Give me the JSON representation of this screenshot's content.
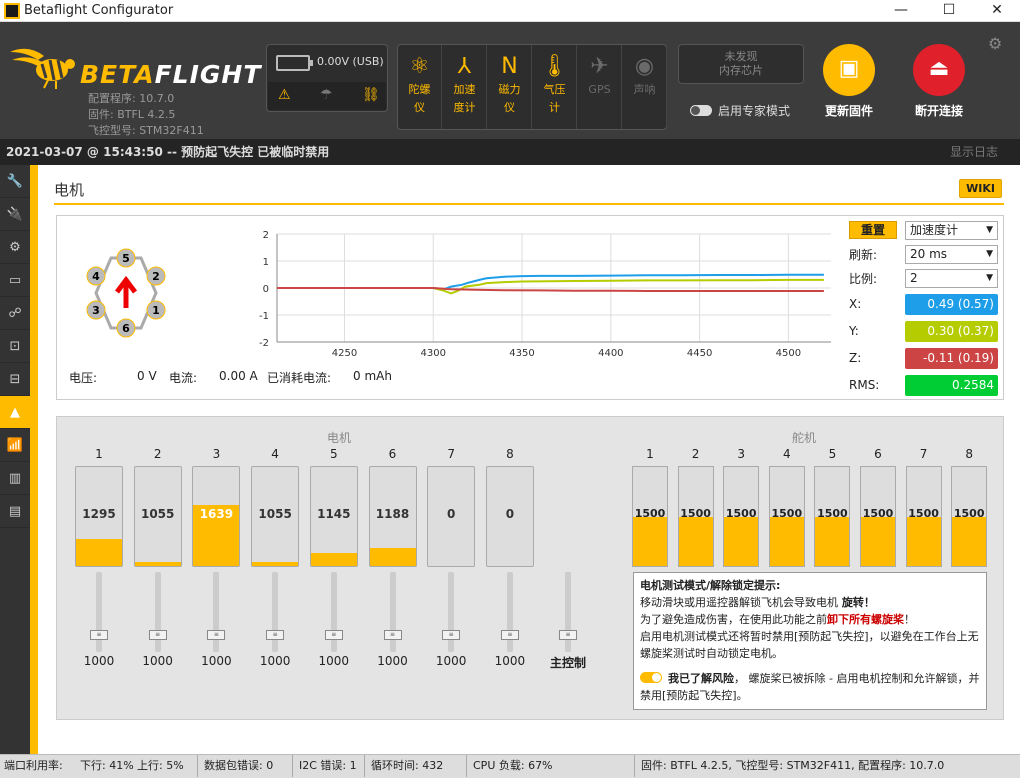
{
  "window": {
    "title": "Betaflight Configurator",
    "min": "—",
    "max": "☐",
    "close": "✕"
  },
  "header": {
    "logo_text_a": "BETA",
    "logo_text_b": "FLIGHT",
    "version_lines": [
      "配置程序: 10.7.0",
      "固件: BTFL 4.2.5",
      "飞控型号: STM32F411"
    ],
    "voltage": "0.00V (USB)",
    "sensors": [
      {
        "glyph": "⚛",
        "label_a": "陀螺",
        "label_b": "仪",
        "state": "on",
        "icon": "gyro-icon"
      },
      {
        "glyph": "⅄",
        "label_a": "加速",
        "label_b": "度计",
        "state": "on",
        "icon": "accel-icon"
      },
      {
        "glyph": "N",
        "label_a": "磁力",
        "label_b": "仪",
        "state": "on",
        "icon": "mag-icon"
      },
      {
        "glyph": "🌡",
        "label_a": "气压",
        "label_b": "计",
        "state": "on",
        "icon": "baro-icon"
      },
      {
        "glyph": "✈",
        "label_a": "GPS",
        "label_b": "",
        "state": "off",
        "icon": "gps-icon"
      },
      {
        "glyph": "◉",
        "label_a": "声呐",
        "label_b": "",
        "state": "off",
        "icon": "sonar-icon"
      }
    ],
    "chip_line1": "未发现",
    "chip_line2": "内存芯片",
    "expert_mode": "启用专家模式",
    "update_fw": "更新固件",
    "disconnect": "断开连接"
  },
  "infobar": {
    "message": "2021-03-07 @ 15:43:50 -- 预防起飞失控 已被临时禁用",
    "log": "显示日志"
  },
  "page": {
    "title": "电机",
    "wiki": "WIKI"
  },
  "telemetry": {
    "voltage_label": "电压:",
    "voltage": "0 V",
    "current_label": "电流:",
    "current": "0.00 A",
    "consumed_label": "已消耗电流:",
    "consumed": "0 mAh"
  },
  "graph_controls": {
    "reset": "重置",
    "sensor": "加速度计",
    "refresh_label": "刷新:",
    "refresh": "20 ms",
    "scale_label": "比例:",
    "scale": "2",
    "x_label": "X:",
    "x_val": "0.49 (0.57)",
    "y_label": "Y:",
    "y_val": "0.30 (0.37)",
    "z_label": "Z:",
    "z_val": "-0.11 (0.19)",
    "rms_label": "RMS:",
    "rms_val": "0.2584",
    "colors": {
      "x": "#1e9ee8",
      "y": "#b5cc00",
      "z": "#cc4444",
      "rms": "#00cc33"
    }
  },
  "chart_data": {
    "type": "line",
    "xlim": [
      4212,
      4524
    ],
    "ylim": [
      -2,
      2
    ],
    "xticks": [
      4250,
      4300,
      4350,
      4400,
      4450,
      4500
    ],
    "yticks": [
      2,
      1,
      0,
      -1,
      -2
    ],
    "series": [
      {
        "color": "#1e9ee8",
        "x": [
          4212,
          4300,
          4306,
          4310,
          4316,
          4320,
          4326,
          4330,
          4340,
          4350,
          4360,
          4380,
          4400,
          4420,
          4440,
          4460,
          4480,
          4500,
          4520
        ],
        "y": [
          0,
          0,
          -0.05,
          0.05,
          0.12,
          0.2,
          0.3,
          0.36,
          0.42,
          0.44,
          0.45,
          0.45,
          0.46,
          0.47,
          0.47,
          0.48,
          0.48,
          0.49,
          0.49
        ]
      },
      {
        "color": "#b5cc00",
        "x": [
          4212,
          4300,
          4306,
          4310,
          4314,
          4318,
          4326,
          4330,
          4340,
          4350,
          4380,
          4400,
          4420,
          4440,
          4460,
          4480,
          4500,
          4520
        ],
        "y": [
          0,
          0,
          -0.1,
          -0.2,
          -0.1,
          0.05,
          0.12,
          0.18,
          0.22,
          0.24,
          0.26,
          0.27,
          0.28,
          0.28,
          0.29,
          0.29,
          0.3,
          0.3
        ]
      },
      {
        "color": "#cc4444",
        "x": [
          4212,
          4300,
          4310,
          4320,
          4340,
          4360,
          4380,
          4400,
          4420,
          4440,
          4460,
          4480,
          4500,
          4520
        ],
        "y": [
          0,
          0,
          -0.05,
          -0.06,
          -0.08,
          -0.09,
          -0.1,
          -0.1,
          -0.11,
          -0.11,
          -0.11,
          -0.11,
          -0.11,
          -0.11
        ]
      }
    ]
  },
  "motors": {
    "group_label": "电机",
    "items": [
      {
        "n": "1",
        "value": "1295",
        "level": 0.27,
        "slider": "1000"
      },
      {
        "n": "2",
        "value": "1055",
        "level": 0.04,
        "slider": "1000"
      },
      {
        "n": "3",
        "value": "1639",
        "level": 0.62,
        "slider": "1000"
      },
      {
        "n": "4",
        "value": "1055",
        "level": 0.04,
        "slider": "1000"
      },
      {
        "n": "5",
        "value": "1145",
        "level": 0.13,
        "slider": "1000"
      },
      {
        "n": "6",
        "value": "1188",
        "level": 0.18,
        "slider": "1000"
      },
      {
        "n": "7",
        "value": "0",
        "level": 0,
        "slider": "1000"
      },
      {
        "n": "8",
        "value": "0",
        "level": 0,
        "slider": "1000"
      }
    ],
    "master_label": "主控制"
  },
  "servos": {
    "group_label": "舵机",
    "items": [
      {
        "n": "1",
        "value": "1500"
      },
      {
        "n": "2",
        "value": "1500"
      },
      {
        "n": "3",
        "value": "1500"
      },
      {
        "n": "4",
        "value": "1500"
      },
      {
        "n": "5",
        "value": "1500"
      },
      {
        "n": "6",
        "value": "1500"
      },
      {
        "n": "7",
        "value": "1500"
      },
      {
        "n": "8",
        "value": "1500"
      }
    ]
  },
  "notice": {
    "title": "电机测试模式/解除锁定提示:",
    "l1a": "移动滑块或用遥控器解锁飞机会导致电机",
    "l1b": " 旋转！",
    "l2a": "为了避免造成伤害，在使用此功能之前",
    "l2b": "卸下所有螺旋桨",
    "l2c": "！",
    "l3": "启用电机测试模式还将暂时禁用[预防起飞失控]，以避免在工作台上无螺旋桨测试时自动锁定电机。",
    "ack_bold": "我已了解风险",
    "ack_rest": "， 螺旋桨已被拆除 - 启用电机控制和允许解锁，并禁用[预防起飞失控]。"
  },
  "footer": {
    "port": "端口利用率:",
    "down": "下行: 41%",
    "up": "上行: 5%",
    "packet": "数据包错误: 0",
    "i2c": "I2C 错误: 1",
    "cycle": "循环时间: 432",
    "cpu": "CPU 负载: 67%",
    "fw": "固件: BTFL 4.2.5, 飞控型号: STM32F411, 配置程序: 10.7.0"
  }
}
